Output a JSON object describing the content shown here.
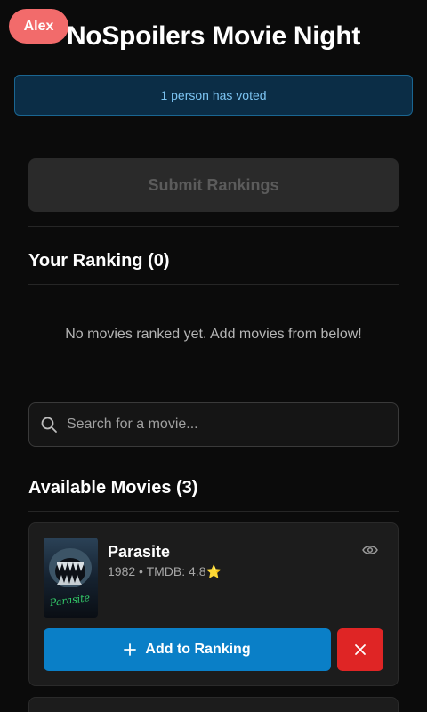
{
  "header": {
    "user_name": "Alex",
    "title": "NoSpoilers Movie Night"
  },
  "vote_status": "1 person has voted",
  "actions": {
    "submit_label": "Submit Rankings"
  },
  "ranking": {
    "title": "Your Ranking (0)",
    "empty_message": "No movies ranked yet. Add movies from below!"
  },
  "search": {
    "placeholder": "Search for a movie..."
  },
  "available": {
    "title": "Available Movies (3)",
    "movies": [
      {
        "title": "Parasite",
        "meta": "1982 • TMDB: 4.8⭐",
        "poster_text": "Parasite",
        "add_label": "Add to Ranking"
      }
    ]
  },
  "colors": {
    "user_badge": "#f26b6b",
    "primary": "#0a7fc7",
    "danger": "#df2525",
    "info_bg": "#0b2d46",
    "background": "#0b0b0b"
  },
  "icons": {
    "search": "search-icon",
    "eye": "eye-icon",
    "plus": "plus-icon",
    "close": "close-icon"
  }
}
